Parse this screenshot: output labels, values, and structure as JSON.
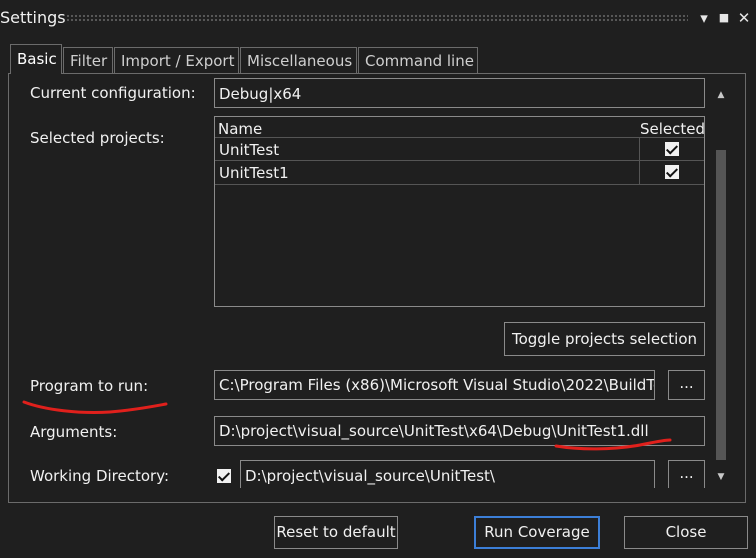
{
  "window": {
    "title": "Settings",
    "controls": {
      "dropdown": "▾",
      "maximize": "■",
      "close": "✕"
    }
  },
  "tabs": [
    {
      "label": "Basic",
      "active": true
    },
    {
      "label": "Filter"
    },
    {
      "label": "Import / Export"
    },
    {
      "label": "Miscellaneous"
    },
    {
      "label": "Command line"
    }
  ],
  "basic": {
    "current_configuration": {
      "label": "Current configuration:",
      "value": "Debug|x64"
    },
    "selected_projects": {
      "label": "Selected projects:",
      "columns": {
        "name": "Name",
        "selected": "Selected"
      },
      "rows": [
        {
          "name": "UnitTest",
          "selected": true
        },
        {
          "name": "UnitTest1",
          "selected": true
        }
      ]
    },
    "toggle_button": "Toggle projects selection",
    "program_to_run": {
      "label": "Program to run:",
      "value": "C:\\Program Files (x86)\\Microsoft Visual Studio\\2022\\BuildTo",
      "browse": "..."
    },
    "arguments": {
      "label": "Arguments:",
      "value": "D:\\project\\visual_source\\UnitTest\\x64\\Debug\\UnitTest1.dll"
    },
    "working_directory": {
      "label": "Working Directory:",
      "enabled": true,
      "value": "D:\\project\\visual_source\\UnitTest\\",
      "browse": "..."
    }
  },
  "footer": {
    "reset": "Reset to default",
    "run": "Run Coverage",
    "close": "Close"
  },
  "colors": {
    "background": "#1f1f1f",
    "accent": "#3c7fd8",
    "annotation": "#e0201c"
  }
}
